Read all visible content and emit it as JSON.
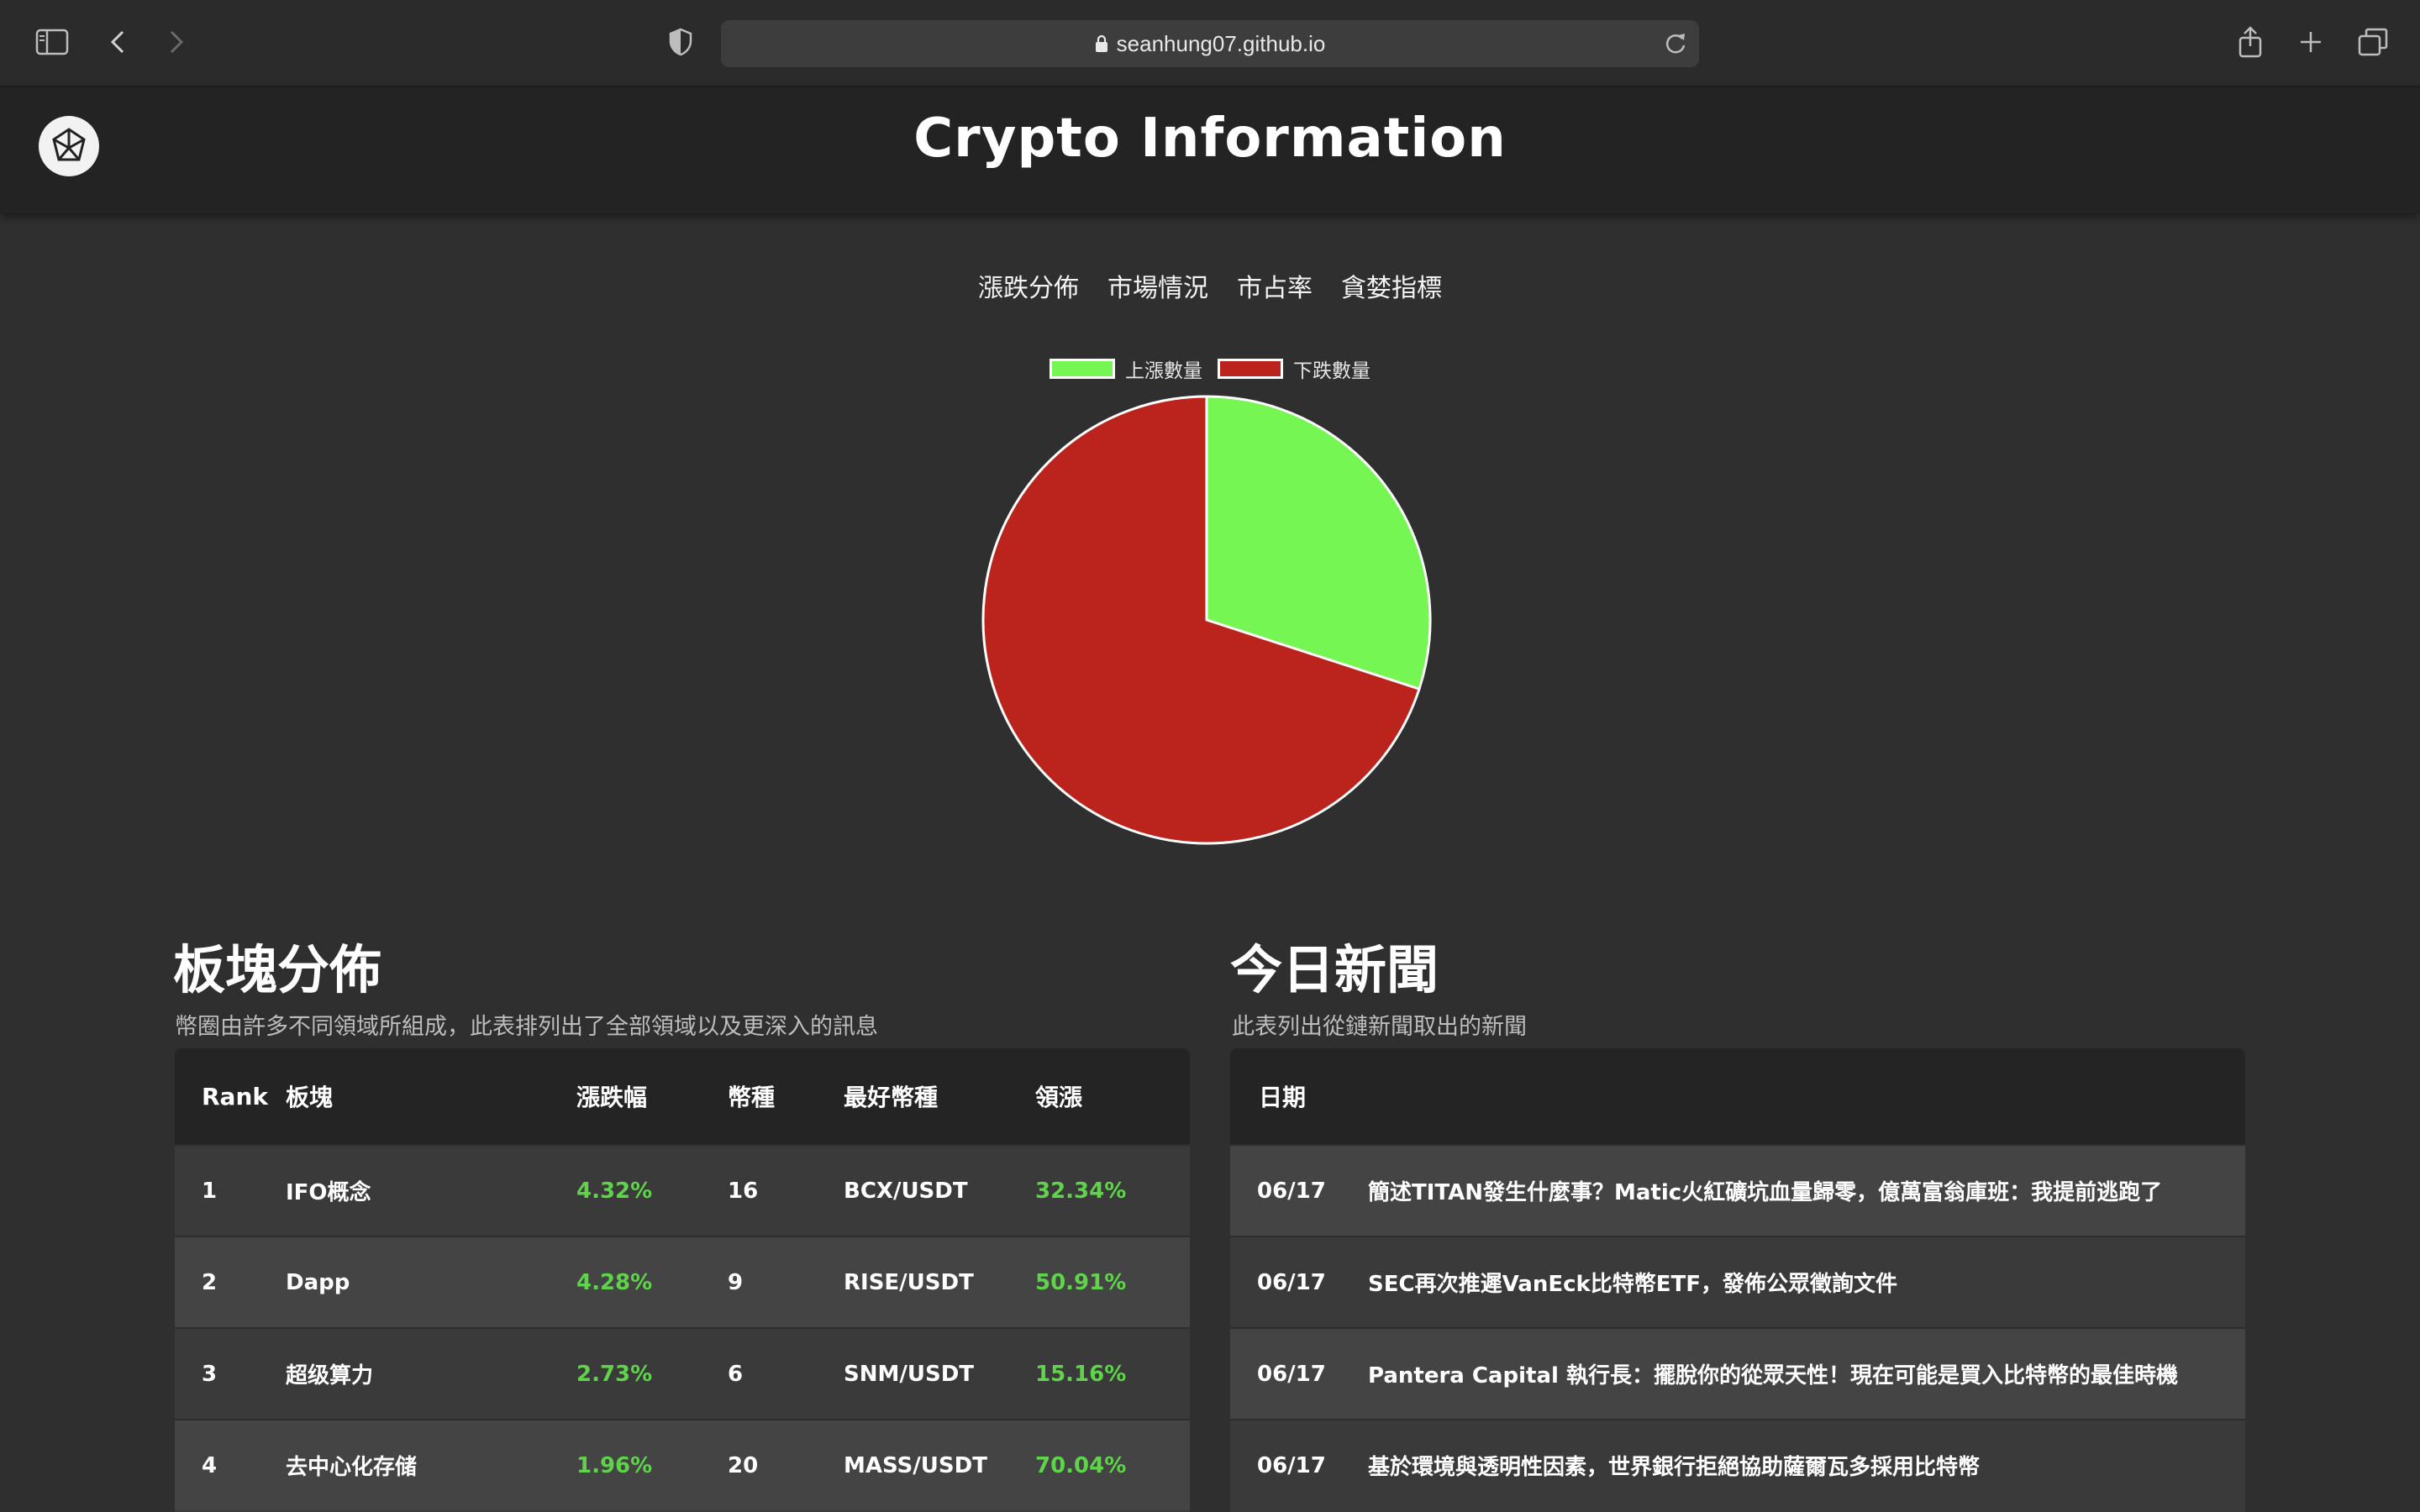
{
  "browser": {
    "url": "seanhung07.github.io"
  },
  "header": {
    "title": "Crypto Information"
  },
  "tabs": [
    "漲跌分佈",
    "市場情況",
    "市占率",
    "貪婪指標"
  ],
  "chart_data": {
    "type": "pie",
    "series": [
      {
        "name": "上漲數量",
        "value": 30,
        "color": "#76f652"
      },
      {
        "name": "下跌數量",
        "value": 70,
        "color": "#bb241c"
      }
    ],
    "legend_position": "top"
  },
  "sectors": {
    "title": "板塊分佈",
    "subtitle": "幣圈由許多不同領域所組成，此表排列出了全部領域以及更深入的訊息",
    "columns": [
      "Rank",
      "板塊",
      "漲跌幅",
      "幣種",
      "最好幣種",
      "領漲"
    ],
    "rows": [
      {
        "rank": "1",
        "sector": "IFO概念",
        "change": "4.32%",
        "coins": "16",
        "best": "BCX/USDT",
        "lead": "32.34%"
      },
      {
        "rank": "2",
        "sector": "Dapp",
        "change": "4.28%",
        "coins": "9",
        "best": "RISE/USDT",
        "lead": "50.91%"
      },
      {
        "rank": "3",
        "sector": "超级算力",
        "change": "2.73%",
        "coins": "6",
        "best": "SNM/USDT",
        "lead": "15.16%"
      },
      {
        "rank": "4",
        "sector": "去中心化存储",
        "change": "1.96%",
        "coins": "20",
        "best": "MASS/USDT",
        "lead": "70.04%"
      }
    ]
  },
  "news": {
    "title": "今日新聞",
    "subtitle": "此表列出從鏈新聞取出的新聞",
    "columns": [
      "日期"
    ],
    "rows": [
      {
        "date": "06/17",
        "headline": "簡述TITAN發生什麼事？Matic火紅礦坑血量歸零，億萬富翁庫班：我提前逃跑了"
      },
      {
        "date": "06/17",
        "headline": "SEC再次推遲VanEck比特幣ETF，發佈公眾徵詢文件"
      },
      {
        "date": "06/17",
        "headline": "Pantera Capital 執行長：擺脫你的從眾天性！現在可能是買入比特幣的最佳時機"
      },
      {
        "date": "06/17",
        "headline": "基於環境與透明性因素，世界銀行拒絕協助薩爾瓦多採用比特幣"
      }
    ]
  }
}
